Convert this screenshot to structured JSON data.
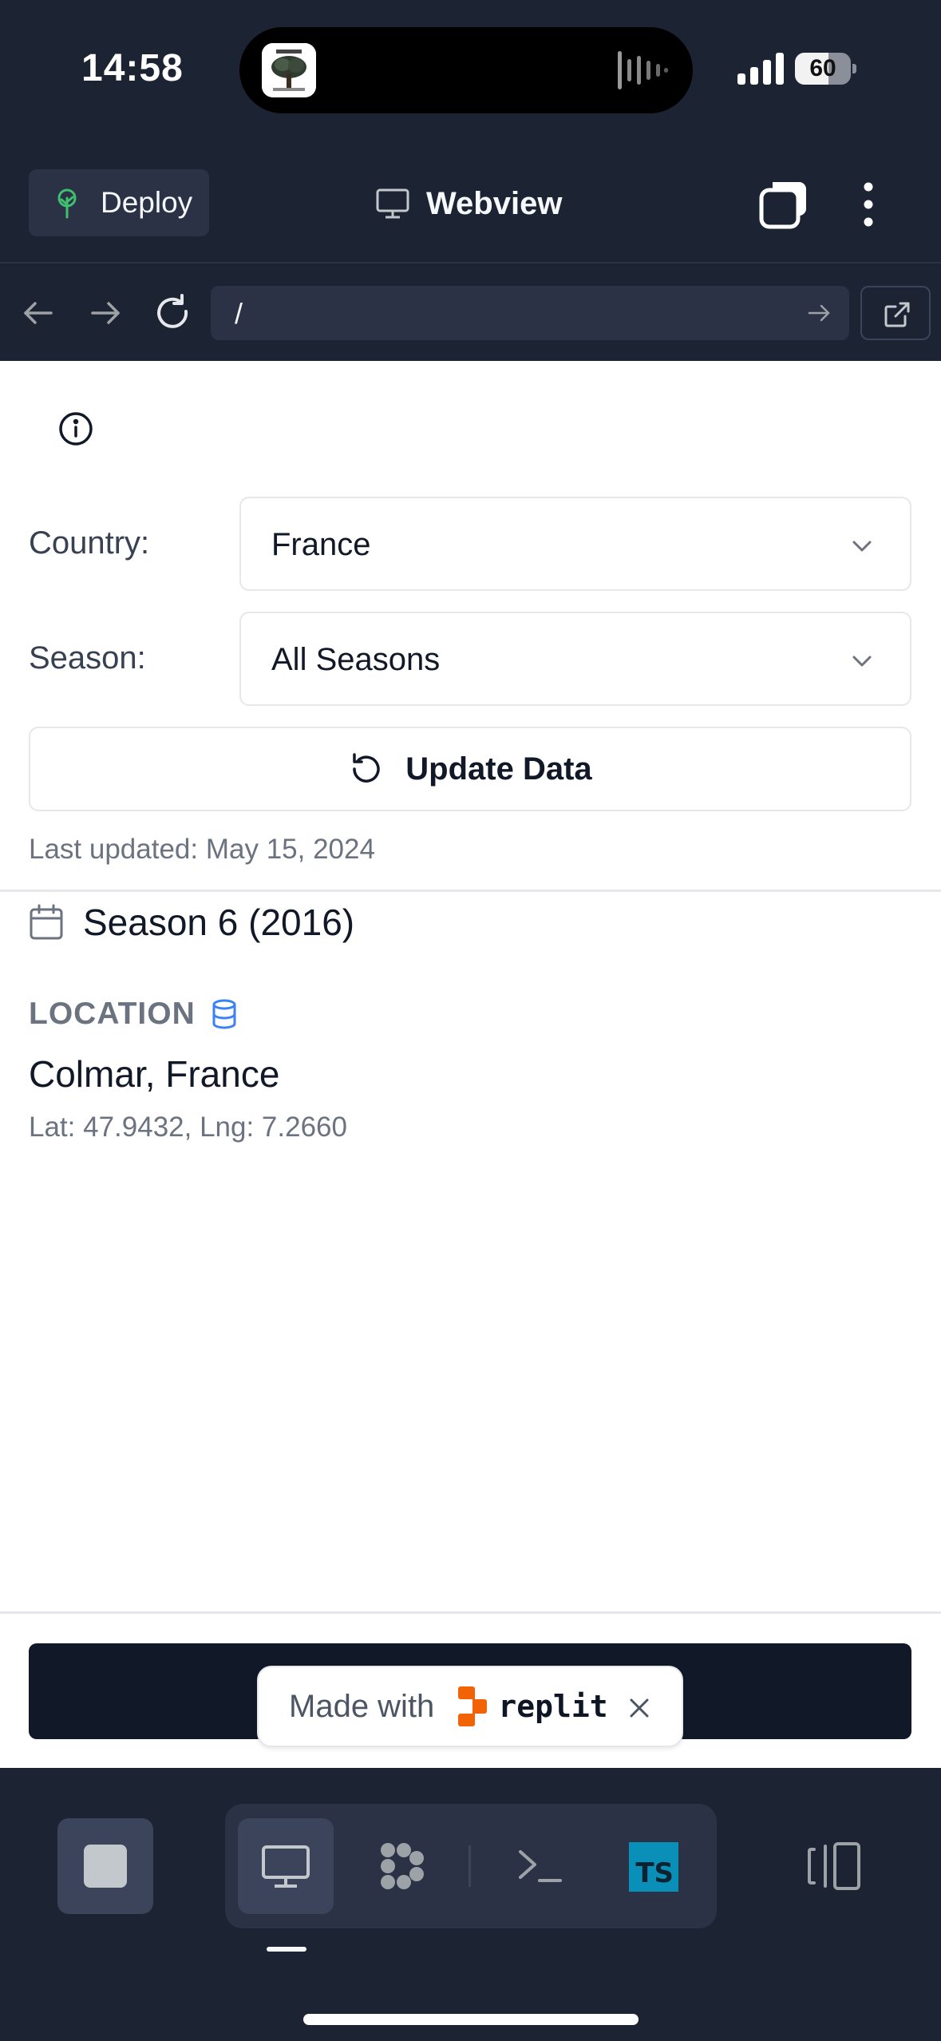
{
  "status_bar": {
    "time": "14:58",
    "battery": "60",
    "battery_level_percent": 60
  },
  "header": {
    "deploy_label": "Deploy",
    "title": "Webview"
  },
  "url_bar": {
    "url": "/"
  },
  "filters": {
    "country_label": "Country:",
    "country_value": "France",
    "season_label": "Season:",
    "season_value": "All Seasons",
    "update_label": "Update Data",
    "last_updated": "Last updated: May 15, 2024"
  },
  "result": {
    "season": "Season 6 (2016)",
    "location_label": "LOCATION",
    "location_name": "Colmar, France",
    "coordinates": "Lat: 47.9432, Lng: 7.2660"
  },
  "badge": {
    "made_with": "Made with",
    "brand": "replit"
  },
  "toolbar": {
    "ts_label": "TS"
  },
  "colors": {
    "ide_background": "#1c2333",
    "ide_surface": "#2b3245",
    "replit_orange": "#f26207",
    "database_blue": "#3b82f6",
    "typescript_blue": "#0a8fb8"
  }
}
